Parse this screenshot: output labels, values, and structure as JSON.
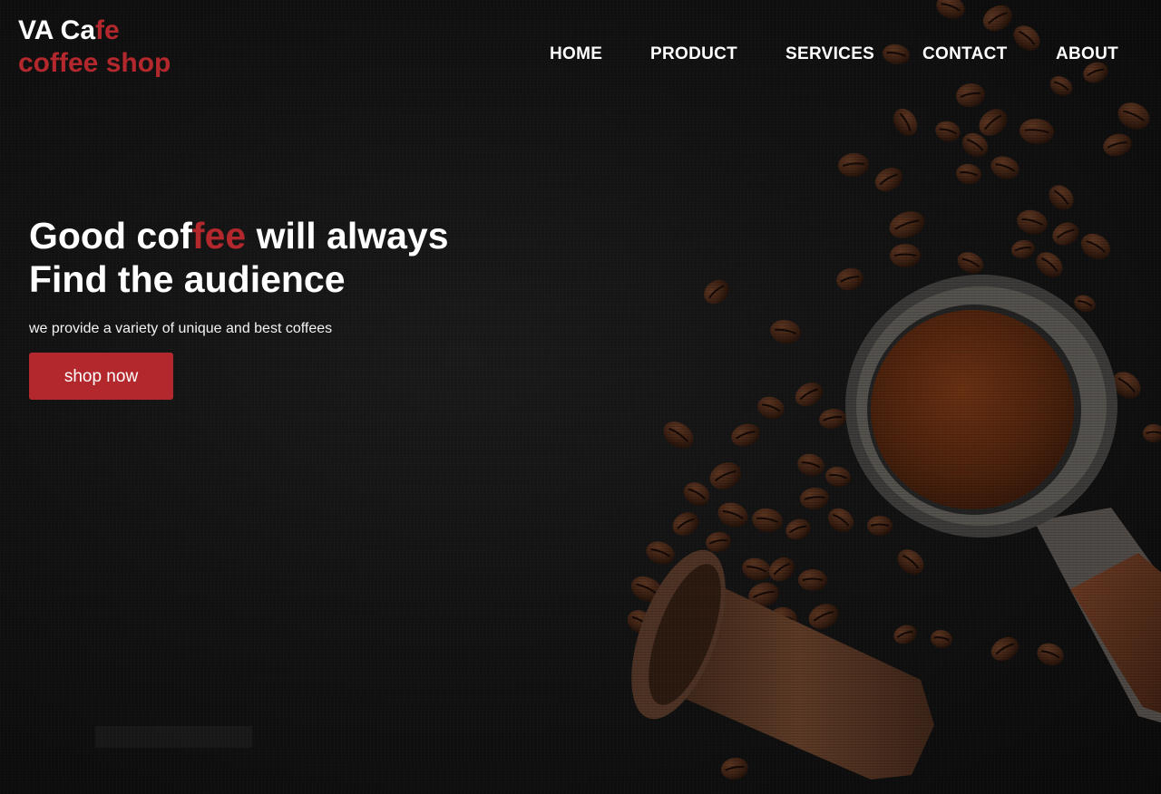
{
  "brand": {
    "line1_prefix": "VA Ca",
    "line1_accent": "fe",
    "line2": "coffee shop"
  },
  "nav": {
    "items": [
      {
        "label": "HOME"
      },
      {
        "label": "PRODUCT"
      },
      {
        "label": "SERVICES"
      },
      {
        "label": "CONTACT"
      },
      {
        "label": "ABOUT"
      }
    ]
  },
  "hero": {
    "title_part1": "Good cof",
    "title_accent": "fee",
    "title_part2": " will always",
    "title_line2": "Find the audience",
    "subtitle": "we provide a variety of unique and best coffees",
    "cta_label": "shop now"
  },
  "colors": {
    "accent": "#b3282d",
    "background": "#121212",
    "text": "#ffffff"
  },
  "images": {
    "background": "coffee-beans-portafilter-photo"
  }
}
